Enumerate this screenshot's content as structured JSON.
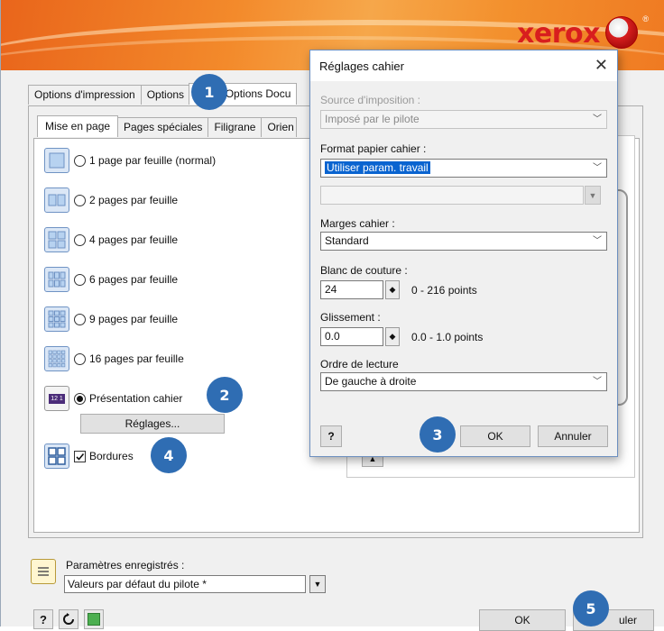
{
  "brand": {
    "logo_text": "xerox",
    "reg_mark": "®"
  },
  "tabs": [
    "Options d'impression",
    "Options",
    "Options Docu"
  ],
  "subtabs": [
    "Mise en page",
    "Pages spéciales",
    "Filigrane",
    "Orien"
  ],
  "layout_options": [
    {
      "label": "1 page par feuille (normal)",
      "selected": false,
      "icon": "1-page-icon"
    },
    {
      "label": "2 pages par feuille",
      "selected": false,
      "icon": "2-pages-icon"
    },
    {
      "label": "4 pages par feuille",
      "selected": false,
      "icon": "4-pages-icon"
    },
    {
      "label": "6 pages par feuille",
      "selected": false,
      "icon": "6-pages-icon"
    },
    {
      "label": "9 pages par feuille",
      "selected": false,
      "icon": "9-pages-icon"
    },
    {
      "label": "16 pages par feuille",
      "selected": false,
      "icon": "16-pages-icon"
    },
    {
      "label": "Présentation cahier",
      "selected": true,
      "icon": "booklet-icon"
    }
  ],
  "booklet_icon_text": "12 1",
  "settings_button": "Réglages...",
  "borders": {
    "label": "Bordures",
    "checked": true
  },
  "saved_settings": {
    "label": "Paramètres enregistrés :",
    "value": "Valeurs par défaut du pilote *"
  },
  "bottom_buttons": {
    "help": "?",
    "ok": "OK",
    "cancel_partial": "uler"
  },
  "dialog": {
    "title": "Réglages cahier",
    "close": "✕",
    "imposition_label": "Source d'imposition :",
    "imposition_value": "Imposé par le pilote",
    "paper_label": "Format papier cahier :",
    "paper_value": "Utiliser param. travail",
    "margins_label": "Marges cahier :",
    "margins_value": "Standard",
    "gutter_label": "Blanc de couture :",
    "gutter_value": "24",
    "gutter_range": "0 - 216 points",
    "creep_label": "Glissement :",
    "creep_value": "0.0",
    "creep_range": "0.0 - 1.0 points",
    "reading_label": "Ordre de lecture",
    "reading_value": "De gauche à droite",
    "help": "?",
    "ok": "OK",
    "cancel": "Annuler"
  },
  "callouts": [
    "1",
    "2",
    "3",
    "4",
    "5"
  ],
  "colors": {
    "callout": "#2f6db3",
    "banner": "#f08a2c",
    "selection": "#0a64d0"
  }
}
